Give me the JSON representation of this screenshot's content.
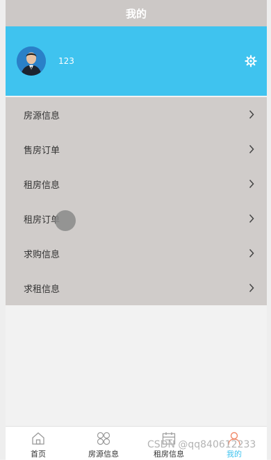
{
  "header": {
    "title": "我的"
  },
  "profile": {
    "username": "123"
  },
  "menu": {
    "items": [
      {
        "label": "房源信息"
      },
      {
        "label": "售房订单"
      },
      {
        "label": "租房信息"
      },
      {
        "label": "租房订单"
      },
      {
        "label": "求购信息"
      },
      {
        "label": "求租信息"
      }
    ]
  },
  "tabbar": {
    "tabs": [
      {
        "label": "首页",
        "icon": "home-icon"
      },
      {
        "label": "房源信息",
        "icon": "grid-icon"
      },
      {
        "label": "租房信息",
        "icon": "calendar-icon"
      },
      {
        "label": "我的",
        "icon": "user-icon"
      }
    ],
    "active": "我的"
  },
  "watermark": {
    "text": "CSDN @qq840612233"
  },
  "colors": {
    "accent": "#3fc3ef",
    "navbar": "#ccc8c6",
    "menu_bg": "#d0ccca",
    "page_bg": "#f2f2f2"
  }
}
